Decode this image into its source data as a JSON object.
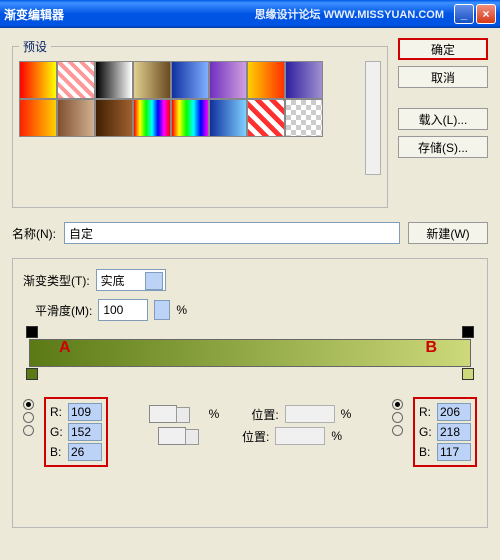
{
  "titlebar": {
    "title": "渐变编辑器",
    "watermark": "思缘设计论坛  WWW.MISSYUAN.COM"
  },
  "buttons": {
    "ok": "确定",
    "cancel": "取消",
    "load": "载入(L)...",
    "save": "存储(S)..."
  },
  "preset_legend": "预设",
  "name": {
    "label": "名称(N):",
    "value": "自定",
    "new_btn": "新建(W)"
  },
  "grad": {
    "type_label": "渐变类型(T):",
    "type_value": "实底",
    "smooth_label": "平滑度(M):",
    "smooth_value": "100",
    "smooth_unit": "%"
  },
  "annotations": {
    "a": "A",
    "b": "B"
  },
  "mid": {
    "pos_label": "位置:",
    "unit": "%"
  },
  "rgb_a": {
    "r_label": "R:",
    "g_label": "G:",
    "b_label": "B:",
    "r": "109",
    "g": "152",
    "b": "26"
  },
  "rgb_b": {
    "r_label": "R:",
    "g_label": "G:",
    "b_label": "B:",
    "r": "206",
    "g": "218",
    "b": "117"
  },
  "swatch_colors": [
    "linear-gradient(90deg,#ff0000,#ffff00)",
    "repeating-linear-gradient(45deg,#f99,#f99 4px,#fff 4px,#fff 8px)",
    "linear-gradient(90deg,#000,#fff)",
    "linear-gradient(90deg,#e0d090,#6b4a20)",
    "linear-gradient(90deg,#1030a0,#80b0ff)",
    "linear-gradient(90deg,#7030c0,#d0a0e0)",
    "linear-gradient(90deg,#ffd000,#ff3000)",
    "linear-gradient(90deg,#3020a0,#a090d0)",
    "linear-gradient(90deg,#ff2000,#ffd000)",
    "linear-gradient(90deg,#805030,#d0b090)",
    "linear-gradient(90deg,#402000,#a06030)",
    "linear-gradient(90deg,red,yellow,lime,cyan,blue,magenta,red)",
    "linear-gradient(90deg,red,yellow,lime,cyan,blue,magenta)",
    "linear-gradient(90deg,#1030a0,#80d0ff)",
    "repeating-linear-gradient(45deg,#ff3030,#ff3030 5px,#fff 5px,#fff 10px)",
    "repeating-conic-gradient(#ccc 0 25%,#fff 0 50%) 0 0/10px 10px"
  ]
}
